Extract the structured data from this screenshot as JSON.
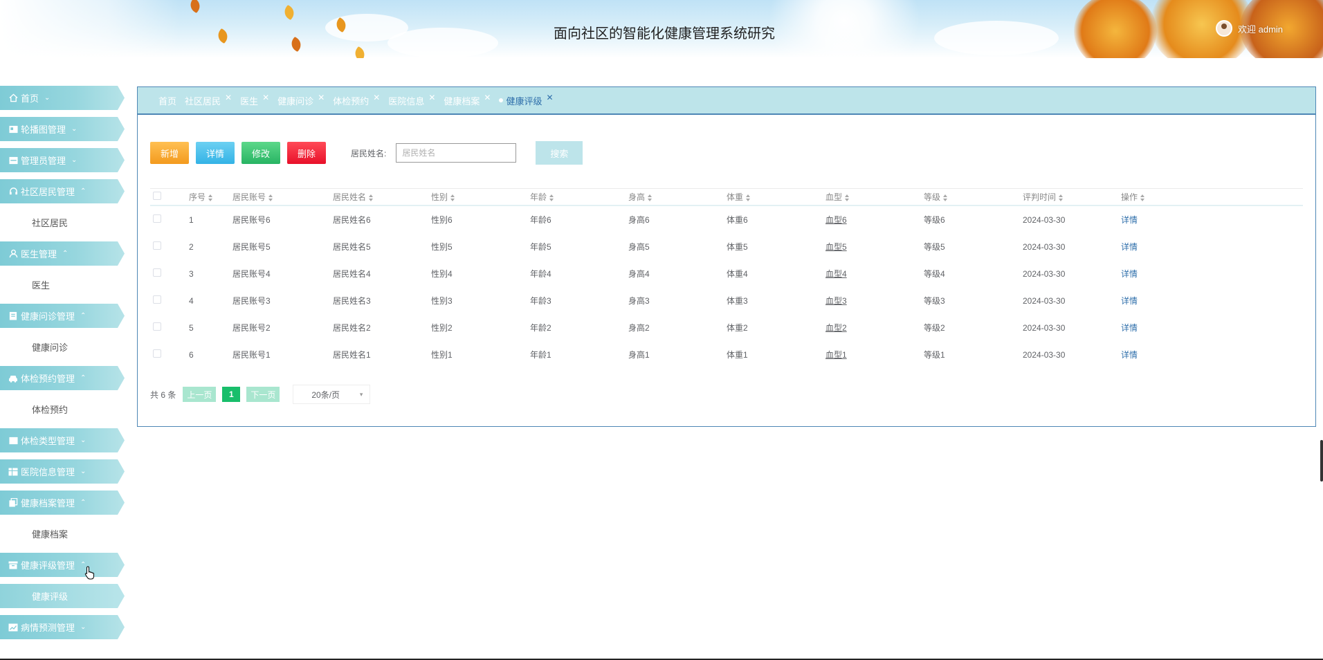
{
  "header": {
    "title": "面向社区的智能化健康管理系统研究",
    "welcome": "欢迎 admin"
  },
  "sidebar": {
    "items": [
      {
        "label": "首页",
        "icon": "home-icon",
        "chevron": "⌄"
      },
      {
        "label": "轮播图管理",
        "icon": "image-icon",
        "chevron": "⌄"
      },
      {
        "label": "管理员管理",
        "icon": "admin-icon",
        "chevron": "⌄"
      },
      {
        "label": "社区居民管理",
        "icon": "headset-icon",
        "chevron": "⌃",
        "sub": "社区居民"
      },
      {
        "label": "医生管理",
        "icon": "user-icon",
        "chevron": "⌃",
        "sub": "医生"
      },
      {
        "label": "健康问诊管理",
        "icon": "clipboard-icon",
        "chevron": "⌃",
        "sub": "健康问诊"
      },
      {
        "label": "体检预约管理",
        "icon": "car-icon",
        "chevron": "⌃",
        "sub": "体检预约"
      },
      {
        "label": "体检类型管理",
        "icon": "grid-icon",
        "chevron": "⌄"
      },
      {
        "label": "医院信息管理",
        "icon": "table-icon",
        "chevron": "⌄"
      },
      {
        "label": "健康档案管理",
        "icon": "copy-icon",
        "chevron": "⌃",
        "sub": "健康档案"
      },
      {
        "label": "健康评级管理",
        "icon": "box-icon",
        "chevron": "⌃",
        "sub": "健康评级"
      },
      {
        "label": "病情预测管理",
        "icon": "chart-icon",
        "chevron": "⌄"
      }
    ]
  },
  "tabs": [
    {
      "label": "首页",
      "closable": false
    },
    {
      "label": "社区居民",
      "closable": true
    },
    {
      "label": "医生",
      "closable": true
    },
    {
      "label": "健康问诊",
      "closable": true
    },
    {
      "label": "体检预约",
      "closable": true
    },
    {
      "label": "医院信息",
      "closable": true
    },
    {
      "label": "健康档案",
      "closable": true
    },
    {
      "label": "健康评级",
      "closable": true,
      "active": true
    }
  ],
  "toolbar": {
    "add": "新增",
    "detail": "详情",
    "edit": "修改",
    "delete": "删除",
    "search_label": "居民姓名:",
    "search_placeholder": "居民姓名",
    "search_button": "搜索"
  },
  "table": {
    "headers": [
      "序号",
      "居民账号",
      "居民姓名",
      "性别",
      "年龄",
      "身高",
      "体重",
      "血型",
      "等级",
      "评判时间",
      "操作"
    ],
    "rows": [
      {
        "idx": "1",
        "account": "居民账号6",
        "name": "居民姓名6",
        "sex": "性别6",
        "age": "年龄6",
        "height": "身高6",
        "weight": "体重6",
        "blood": "血型6",
        "grade": "等级6",
        "time": "2024-03-30",
        "op": "详情"
      },
      {
        "idx": "2",
        "account": "居民账号5",
        "name": "居民姓名5",
        "sex": "性别5",
        "age": "年龄5",
        "height": "身高5",
        "weight": "体重5",
        "blood": "血型5",
        "grade": "等级5",
        "time": "2024-03-30",
        "op": "详情"
      },
      {
        "idx": "3",
        "account": "居民账号4",
        "name": "居民姓名4",
        "sex": "性别4",
        "age": "年龄4",
        "height": "身高4",
        "weight": "体重4",
        "blood": "血型4",
        "grade": "等级4",
        "time": "2024-03-30",
        "op": "详情"
      },
      {
        "idx": "4",
        "account": "居民账号3",
        "name": "居民姓名3",
        "sex": "性别3",
        "age": "年龄3",
        "height": "身高3",
        "weight": "体重3",
        "blood": "血型3",
        "grade": "等级3",
        "time": "2024-03-30",
        "op": "详情"
      },
      {
        "idx": "5",
        "account": "居民账号2",
        "name": "居民姓名2",
        "sex": "性别2",
        "age": "年龄2",
        "height": "身高2",
        "weight": "体重2",
        "blood": "血型2",
        "grade": "等级2",
        "time": "2024-03-30",
        "op": "详情"
      },
      {
        "idx": "6",
        "account": "居民账号1",
        "name": "居民姓名1",
        "sex": "性别1",
        "age": "年龄1",
        "height": "身高1",
        "weight": "体重1",
        "blood": "血型1",
        "grade": "等级1",
        "time": "2024-03-30",
        "op": "详情"
      }
    ]
  },
  "pager": {
    "total": "共 6 条",
    "prev": "上一页",
    "current": "1",
    "next": "下一页",
    "page_size": "20条/页"
  },
  "colors": {
    "accent": "#4d86b5",
    "menu": "#7ecbd6",
    "link": "#2f6fab"
  }
}
